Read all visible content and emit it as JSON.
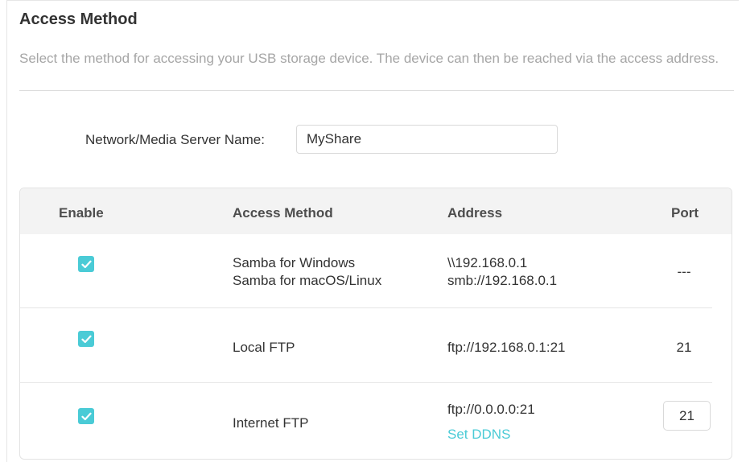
{
  "section": {
    "title": "Access Method",
    "description": "Select the method for accessing your USB storage device. The device can then be reached via the access address."
  },
  "server_name": {
    "label": "Network/Media Server Name:",
    "value": "MyShare"
  },
  "table": {
    "headers": {
      "enable": "Enable",
      "access_method": "Access Method",
      "address": "Address",
      "port": "Port"
    },
    "rows": [
      {
        "enabled": true,
        "method_lines": [
          "Samba for Windows",
          "Samba for macOS/Linux"
        ],
        "address_lines": [
          "\\\\192.168.0.1",
          "smb://192.168.0.1"
        ],
        "port": "---"
      },
      {
        "enabled": true,
        "method": "Local FTP",
        "address": "ftp://192.168.0.1:21",
        "port": "21"
      },
      {
        "enabled": true,
        "method": "Internet FTP",
        "address": "ftp://0.0.0.0:21",
        "link": "Set DDNS",
        "port": "21"
      }
    ]
  },
  "colors": {
    "accent": "#4acbd6",
    "header_bg": "#f3f3f3",
    "muted_text": "#a6a6a6"
  },
  "icons": {
    "checkbox": "checkmark-icon"
  }
}
